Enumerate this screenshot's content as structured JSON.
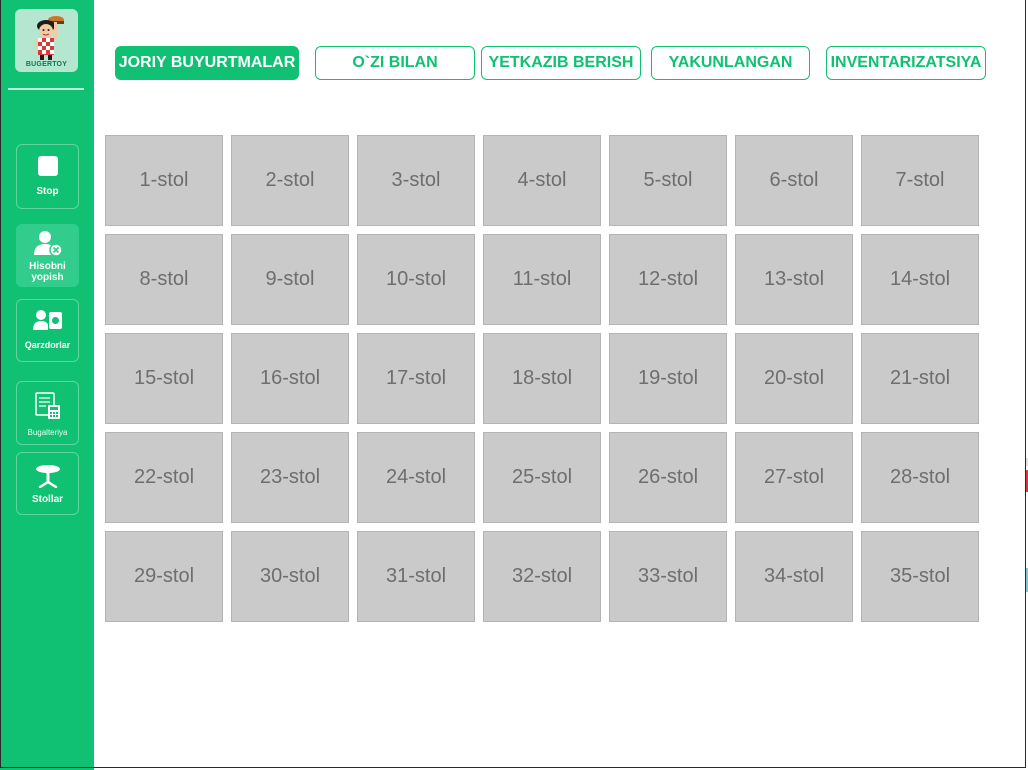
{
  "logo": {
    "brand": "BUGERTOY"
  },
  "sidebar": {
    "items": [
      {
        "label": "Stop",
        "icon": "stop-icon"
      },
      {
        "label": "Hisobni yopish",
        "icon": "user-close-icon",
        "active": true
      },
      {
        "label": "Qarzdorlar",
        "icon": "debtors-icon"
      },
      {
        "label": "Bugalteriya",
        "icon": "accounting-icon"
      },
      {
        "label": "Stollar",
        "icon": "table-icon"
      }
    ]
  },
  "tabs": [
    {
      "label": "JORIY BUYURTMALAR",
      "active": true
    },
    {
      "label": "O`ZI BILAN"
    },
    {
      "label": "YETKAZIB BERISH"
    },
    {
      "label": "YAKUNLANGAN"
    },
    {
      "label": "INVENTARIZATSIYA"
    }
  ],
  "tables": [
    "1-stol",
    "2-stol",
    "3-stol",
    "4-stol",
    "5-stol",
    "6-stol",
    "7-stol",
    "8-stol",
    "9-stol",
    "10-stol",
    "11-stol",
    "12-stol",
    "13-stol",
    "14-stol",
    "15-stol",
    "16-stol",
    "17-stol",
    "18-stol",
    "19-stol",
    "20-stol",
    "21-stol",
    "22-stol",
    "23-stol",
    "24-stol",
    "25-stol",
    "26-stol",
    "27-stol",
    "28-stol",
    "29-stol",
    "30-stol",
    "31-stol",
    "32-stol",
    "33-stol",
    "34-stol",
    "35-stol"
  ],
  "colors": {
    "accent": "#10c073",
    "table_bg": "#cacaca",
    "table_text": "#6e6e6e"
  }
}
